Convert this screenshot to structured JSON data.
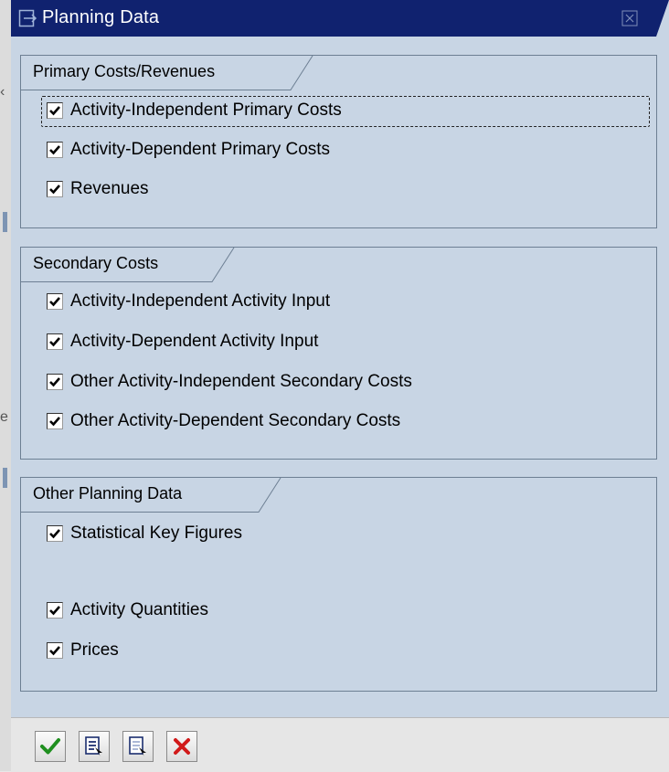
{
  "window": {
    "title": "Planning Data",
    "colors": {
      "titlebar": "#10226f",
      "panel": "#c8d5e4",
      "border": "#6d7f93"
    }
  },
  "groups": [
    {
      "title": "Primary Costs/Revenues",
      "items": [
        {
          "label": "Activity-Independent Primary Costs",
          "checked": true,
          "focused": true
        },
        {
          "label": "Activity-Dependent Primary Costs",
          "checked": true
        },
        {
          "label": "Revenues",
          "checked": true
        }
      ]
    },
    {
      "title": "Secondary Costs",
      "items": [
        {
          "label": "Activity-Independent Activity Input",
          "checked": true
        },
        {
          "label": "Activity-Dependent Activity Input",
          "checked": true
        },
        {
          "label": "Other Activity-Independent Secondary Costs",
          "checked": true
        },
        {
          "label": "Other Activity-Dependent Secondary Costs",
          "checked": true
        }
      ]
    },
    {
      "title": "Other Planning Data",
      "items": [
        {
          "label": "Statistical Key Figures",
          "checked": true
        },
        {
          "label": "Activity Quantities",
          "checked": true
        },
        {
          "label": "Prices",
          "checked": true
        }
      ]
    }
  ],
  "toolbar": {
    "buttons": [
      {
        "name": "confirm-button",
        "icon": "checkmark-icon"
      },
      {
        "name": "select-all-button",
        "icon": "select-all-icon"
      },
      {
        "name": "deselect-all-button",
        "icon": "deselect-all-icon"
      },
      {
        "name": "cancel-button",
        "icon": "cancel-x-icon"
      }
    ]
  }
}
